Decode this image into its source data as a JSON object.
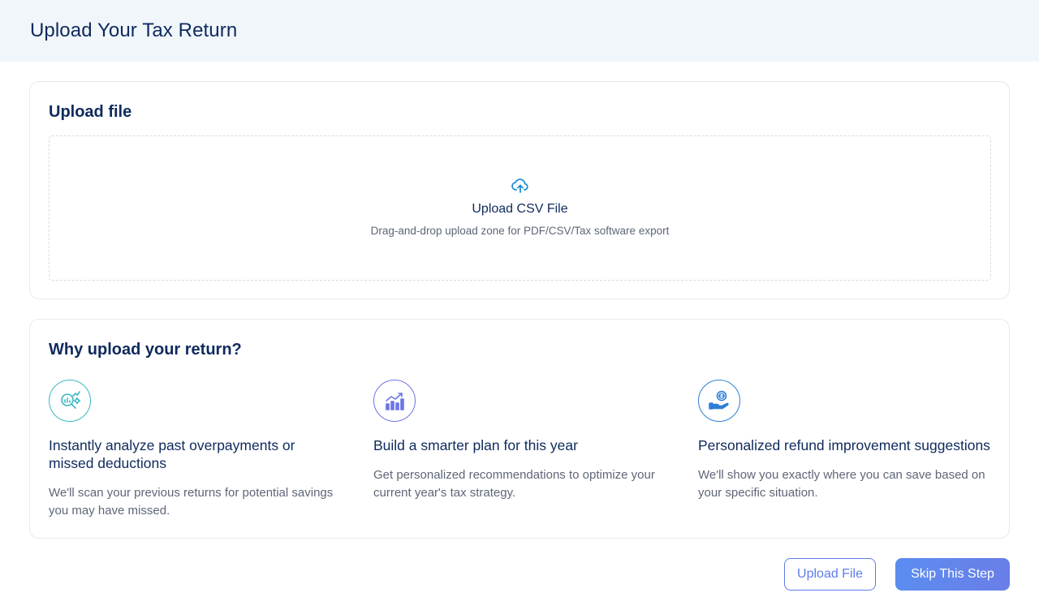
{
  "header": {
    "title": "Upload Your Tax Return"
  },
  "upload": {
    "title": "Upload file",
    "dropzone_title": "Upload CSV File",
    "dropzone_subtitle": "Drag-and-drop upload zone for PDF/CSV/Tax software export",
    "icon": "cloud-upload-icon"
  },
  "why": {
    "title": "Why upload your return?",
    "features": [
      {
        "icon": "analyze-chart-magnifier-icon",
        "title": "Instantly analyze past overpayments or missed deductions",
        "description": "We'll scan your previous returns for potential savings you may have missed."
      },
      {
        "icon": "growth-bar-chart-icon",
        "title": "Build a smarter plan for this year",
        "description": "Get personalized recommendations to optimize your current year's tax strategy."
      },
      {
        "icon": "hand-coin-icon",
        "title": "Personalized refund improvement suggestions",
        "description": "We'll show you exactly where you can save based on your specific situation."
      }
    ]
  },
  "actions": {
    "upload_label": "Upload File",
    "skip_label": "Skip This Step"
  },
  "colors": {
    "primary": "#5e7de8",
    "heading": "#0f2a5c",
    "muted": "#5d6677",
    "header_bg": "#f1f6fb",
    "teal": "#3bb8c0",
    "purple": "#6e74e6",
    "blue": "#2f7fd6"
  }
}
